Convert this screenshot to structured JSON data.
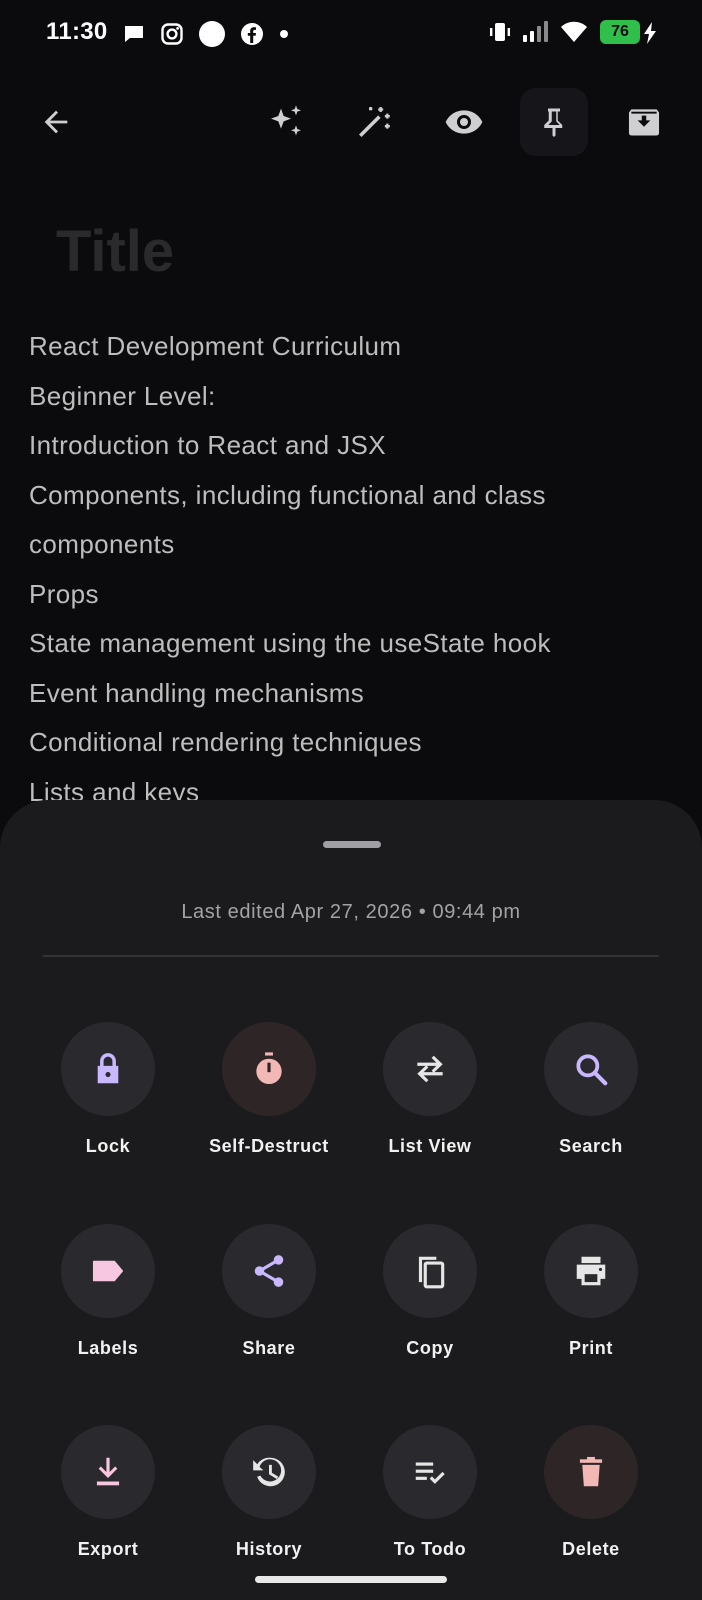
{
  "status_bar": {
    "time": "11:30",
    "battery_level": "76",
    "left_icons": [
      "chat-icon",
      "instagram-icon",
      "circle-icon",
      "facebook-icon",
      "dot-icon"
    ],
    "right_icons": [
      "vibrate-icon",
      "signal-icon",
      "wifi-icon",
      "battery-icon",
      "charging-icon"
    ]
  },
  "toolbar": {
    "icons": [
      "back-arrow-icon",
      "ai-sparkle-icon",
      "magic-wand-icon",
      "eye-icon",
      "pin-icon",
      "archive-icon"
    ]
  },
  "note": {
    "title_placeholder": "Title",
    "lines": [
      "React Development Curriculum",
      "Beginner Level:",
      "Introduction to React and JSX",
      "Components, including functional and class",
      "components",
      "Props",
      "State management using the useState hook",
      "Event handling mechanisms",
      "Conditional rendering techniques",
      "Lists and keys"
    ]
  },
  "sheet": {
    "last_edited": "Last edited Apr 27, 2026 • 09:44 pm",
    "actions": [
      {
        "label": "Lock",
        "icon": "lock-icon",
        "color": "#c9b8ff"
      },
      {
        "label": "Self-Destruct",
        "icon": "timer-icon",
        "color": "#f2b8b5"
      },
      {
        "label": "List View",
        "icon": "swap-arrows-icon",
        "color": "#e6e6e6"
      },
      {
        "label": "Search",
        "icon": "search-icon",
        "color": "#c9b8ff"
      },
      {
        "label": "Labels",
        "icon": "label-icon",
        "color": "#f7c6e0"
      },
      {
        "label": "Share",
        "icon": "share-icon",
        "color": "#c9b8ff"
      },
      {
        "label": "Copy",
        "icon": "copy-icon",
        "color": "#e6e6e6"
      },
      {
        "label": "Print",
        "icon": "print-icon",
        "color": "#e6e6e6"
      },
      {
        "label": "Export",
        "icon": "download-icon",
        "color": "#f7c6e0"
      },
      {
        "label": "History",
        "icon": "history-icon",
        "color": "#e6e6e6"
      },
      {
        "label": "To Todo",
        "icon": "checklist-icon",
        "color": "#e6e6e6"
      },
      {
        "label": "Delete",
        "icon": "trash-icon",
        "color": "#f2b8b5"
      }
    ]
  }
}
